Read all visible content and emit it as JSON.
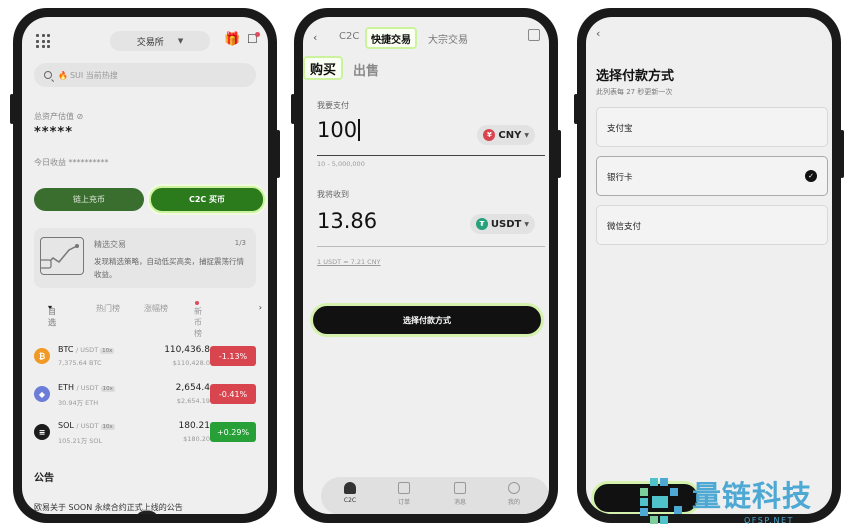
{
  "screen1": {
    "exchange_label": "交易所",
    "search_placeholder": "SUI 当前热搜",
    "assets_label": "总资产估值",
    "assets_value": "*****",
    "today_label": "今日收益 **********",
    "onchain_button": "链上充币",
    "c2c_button": "C2C 买币",
    "card": {
      "title": "精选交易",
      "page": "1/3",
      "text": "发现精选策略，自动低买高卖，捕捉震荡行情收益。"
    },
    "tabs": [
      "自选",
      "热门榜",
      "涨幅榜",
      "新币榜"
    ],
    "coins": [
      {
        "symbol": "BTC",
        "pair": "/ USDT",
        "lev": "10x",
        "vol": "7,375.64 BTC",
        "price": "110,436.8",
        "sub": "$110,428.0",
        "change": "-1.13%",
        "color": "#d8454e",
        "icon_color": "#f09a25",
        "glyph": "₿"
      },
      {
        "symbol": "ETH",
        "pair": "/ USDT",
        "lev": "10x",
        "vol": "30.94万 ETH",
        "price": "2,654.4",
        "sub": "$2,654.19",
        "change": "-0.41%",
        "color": "#d8454e",
        "icon_color": "#6b7dd6",
        "glyph": "◆"
      },
      {
        "symbol": "SOL",
        "pair": "/ USDT",
        "lev": "10x",
        "vol": "105.21万 SOL",
        "price": "180.21",
        "sub": "$180.20",
        "change": "+0.29%",
        "color": "#27a037",
        "icon_color": "#1c1c1c",
        "glyph": "≡"
      }
    ],
    "announcement_title": "公告",
    "announcement_text": "欧易关于 SOON 永续合约正式上线的公告"
  },
  "screen2": {
    "tab_c2c": "C2C",
    "tab_fast": "快捷交易",
    "tab_bulk": "大宗交易",
    "buy": "购买",
    "sell": "出售",
    "pay_label": "我要支付",
    "pay_amount": "100",
    "pay_currency": "CNY",
    "pay_range": "10 - 5,000,000",
    "receive_label": "我将收到",
    "receive_amount": "13.86",
    "receive_currency": "USDT",
    "rate": "1 USDT ≈ 7.21 CNY",
    "pay_method_button": "选择付款方式",
    "nav": [
      "C2C",
      "订单",
      "消息",
      "我的"
    ]
  },
  "screen3": {
    "title": "选择付款方式",
    "subtitle": "此列表每 27 秒更新一次",
    "options": [
      "支付宝",
      "银行卡",
      "微信支付"
    ],
    "selected": "银行卡"
  },
  "watermark": {
    "text": "量链科技",
    "sub": "QFSP.NET"
  }
}
